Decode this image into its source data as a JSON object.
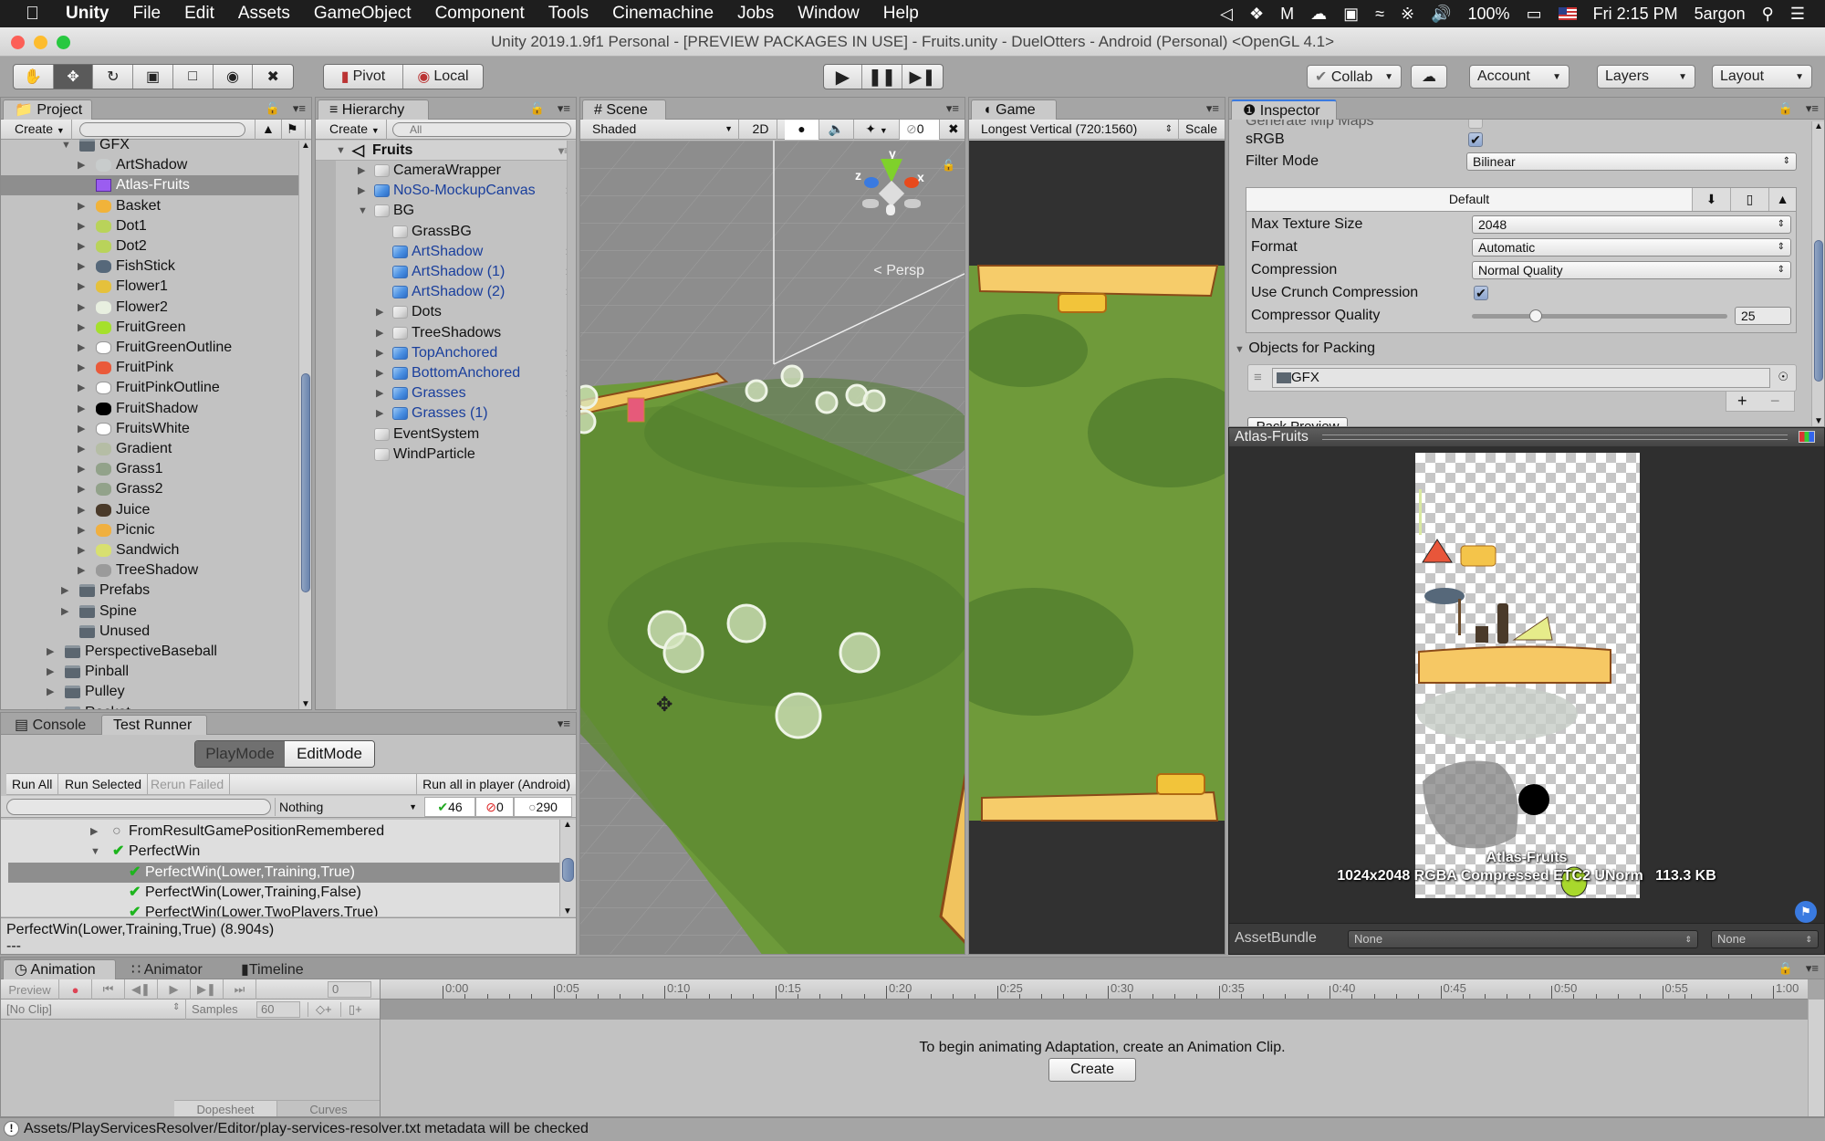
{
  "menubar": {
    "app": "Unity",
    "items": [
      "File",
      "Edit",
      "Assets",
      "GameObject",
      "Component",
      "Tools",
      "Cinemachine",
      "Jobs",
      "Window",
      "Help"
    ],
    "battery": "100%",
    "clock": "Fri 2:15 PM",
    "user": "5argon"
  },
  "window_title": "Unity 2019.1.9f1 Personal - [PREVIEW PACKAGES IN USE] - Fruits.unity - DuelOtters - Android (Personal) <OpenGL 4.1>",
  "toolbar": {
    "tools": [
      "hand-tool",
      "move-tool",
      "rotate-tool",
      "scale-tool",
      "rect-tool",
      "transform-tool",
      "custom-tool"
    ],
    "active_tool": "move-tool",
    "pivot": "Pivot",
    "local": "Local",
    "collab": "Collab",
    "account": "Account",
    "layers": "Layers",
    "layout": "Layout"
  },
  "project": {
    "tab": "Project",
    "create": "Create",
    "search_placeholder": "",
    "items": [
      {
        "label": "GFX",
        "depth": 0,
        "type": "folder",
        "expanded": true
      },
      {
        "label": "ArtShadow",
        "depth": 1,
        "type": "sprite",
        "icon": "#c8cccc"
      },
      {
        "label": "Atlas-Fruits",
        "depth": 1,
        "type": "atlas",
        "selected": true
      },
      {
        "label": "Basket",
        "depth": 1,
        "type": "sprite",
        "icon": "#f1b33a"
      },
      {
        "label": "Dot1",
        "depth": 1,
        "type": "sprite",
        "icon": "#b9d35a"
      },
      {
        "label": "Dot2",
        "depth": 1,
        "type": "sprite",
        "icon": "#b9d35a"
      },
      {
        "label": "FishStick",
        "depth": 1,
        "type": "sprite",
        "icon": "#56687a"
      },
      {
        "label": "Flower1",
        "depth": 1,
        "type": "sprite",
        "icon": "#e5c13c"
      },
      {
        "label": "Flower2",
        "depth": 1,
        "type": "sprite",
        "icon": "#e8efe0"
      },
      {
        "label": "FruitGreen",
        "depth": 1,
        "type": "sprite",
        "icon": "#a5e02c"
      },
      {
        "label": "FruitGreenOutline",
        "depth": 1,
        "type": "sprite",
        "icon": "#ffffff"
      },
      {
        "label": "FruitPink",
        "depth": 1,
        "type": "sprite",
        "icon": "#ea5a3a"
      },
      {
        "label": "FruitPinkOutline",
        "depth": 1,
        "type": "sprite",
        "icon": "#ffffff"
      },
      {
        "label": "FruitShadow",
        "depth": 1,
        "type": "sprite",
        "icon": "#000000"
      },
      {
        "label": "FruitsWhite",
        "depth": 1,
        "type": "sprite",
        "icon": "#ffffff"
      },
      {
        "label": "Gradient",
        "depth": 1,
        "type": "sprite",
        "icon": "#b5bda5"
      },
      {
        "label": "Grass1",
        "depth": 1,
        "type": "sprite",
        "icon": "#92a28a"
      },
      {
        "label": "Grass2",
        "depth": 1,
        "type": "sprite",
        "icon": "#92a28a"
      },
      {
        "label": "Juice",
        "depth": 1,
        "type": "sprite",
        "icon": "#4a3a2a"
      },
      {
        "label": "Picnic",
        "depth": 1,
        "type": "sprite",
        "icon": "#f0b040"
      },
      {
        "label": "Sandwich",
        "depth": 1,
        "type": "sprite",
        "icon": "#d8e070"
      },
      {
        "label": "TreeShadow",
        "depth": 1,
        "type": "sprite",
        "icon": "#9a9a9a"
      },
      {
        "label": "Prefabs",
        "depth": 0,
        "type": "folder",
        "expandable": true
      },
      {
        "label": "Spine",
        "depth": 0,
        "type": "folder",
        "expandable": true
      },
      {
        "label": "Unused",
        "depth": 0,
        "type": "folder"
      },
      {
        "label": "PerspectiveBaseball",
        "depth": -1,
        "type": "folder",
        "expandable": true
      },
      {
        "label": "Pinball",
        "depth": -1,
        "type": "folder",
        "expandable": true
      },
      {
        "label": "Pulley",
        "depth": -1,
        "type": "folder",
        "expandable": true
      },
      {
        "label": "Rocket",
        "depth": -1,
        "type": "folder",
        "expandable": true
      }
    ]
  },
  "hierarchy": {
    "tab": "Hierarchy",
    "create": "Create",
    "search_placeholder": "All",
    "scene": "Fruits",
    "items": [
      {
        "label": "CameraWrapper",
        "depth": 0,
        "prefab": false,
        "expandable": true
      },
      {
        "label": "NoSo-MockupCanvas",
        "depth": 0,
        "prefab": true,
        "expandable": true
      },
      {
        "label": "BG",
        "depth": 0,
        "prefab": false,
        "expanded": true
      },
      {
        "label": "GrassBG",
        "depth": 1,
        "prefab": false
      },
      {
        "label": "ArtShadow",
        "depth": 1,
        "prefab": true
      },
      {
        "label": "ArtShadow (1)",
        "depth": 1,
        "prefab": true
      },
      {
        "label": "ArtShadow (2)",
        "depth": 1,
        "prefab": true
      },
      {
        "label": "Dots",
        "depth": 1,
        "prefab": false,
        "expandable": true
      },
      {
        "label": "TreeShadows",
        "depth": 1,
        "prefab": false,
        "expandable": true
      },
      {
        "label": "TopAnchored",
        "depth": 1,
        "prefab": true,
        "expandable": true
      },
      {
        "label": "BottomAnchored",
        "depth": 1,
        "prefab": true,
        "expandable": true
      },
      {
        "label": "Grasses",
        "depth": 1,
        "prefab": true,
        "expandable": true
      },
      {
        "label": "Grasses (1)",
        "depth": 1,
        "prefab": true,
        "expandable": true
      },
      {
        "label": "EventSystem",
        "depth": 0,
        "prefab": false
      },
      {
        "label": "WindParticle",
        "depth": 0,
        "prefab": false
      }
    ]
  },
  "scene": {
    "tab": "Scene",
    "shading": "Shaded",
    "mode_2d": "2D",
    "hidden_count": "0",
    "projection": "Persp",
    "axes": {
      "x": "x",
      "y": "y",
      "z": "z"
    }
  },
  "game": {
    "tab": "Game",
    "resolution": "Longest Vertical (720:1560)",
    "scale": "Scale"
  },
  "inspector": {
    "tab": "Inspector",
    "cut_label": "Generate Mip Maps",
    "srgb_label": "sRGB",
    "srgb": true,
    "filter_label": "Filter Mode",
    "filter": "Bilinear",
    "platform_tab": "Default",
    "max_size_label": "Max Texture Size",
    "max_size": "2048",
    "format_label": "Format",
    "format": "Automatic",
    "compression_label": "Compression",
    "compression": "Normal Quality",
    "crunch_label": "Use Crunch Compression",
    "crunch": true,
    "quality_label": "Compressor Quality",
    "quality": "25",
    "quality_fraction": 0.25,
    "packing_label": "Objects for Packing",
    "packing_item": "GFX",
    "pack_preview": "Pack Preview"
  },
  "preview": {
    "title": "Atlas-Fruits",
    "name": "Atlas-Fruits",
    "info": "1024x2048 RGBA Compressed ETC2 UNorm   113.3 KB",
    "assetbundle_label": "AssetBundle",
    "assetbundle": "None",
    "variant": "None"
  },
  "testrunner": {
    "tabs": [
      "Console",
      "Test Runner"
    ],
    "active_tab": "Test Runner",
    "modes": [
      "PlayMode",
      "EditMode"
    ],
    "active_mode": "PlayMode",
    "run_all": "Run All",
    "run_selected": "Run Selected",
    "rerun_failed": "Rerun Failed",
    "run_player": "Run all in player (Android)",
    "filter": "Nothing",
    "passed": "46",
    "failed": "0",
    "notrun": "290",
    "tests": [
      {
        "label": "FromResultGamePositionRemembered",
        "state": "notrun",
        "depth": 0,
        "expandable": true
      },
      {
        "label": "PerfectWin",
        "state": "pass",
        "depth": 0,
        "expanded": true
      },
      {
        "label": "PerfectWin(Lower,Training,True)",
        "state": "pass",
        "depth": 1,
        "selected": true
      },
      {
        "label": "PerfectWin(Lower,Training,False)",
        "state": "pass",
        "depth": 1
      },
      {
        "label": "PerfectWin(Lower,TwoPlayers,True)",
        "state": "pass",
        "depth": 1
      }
    ],
    "detail": "PerfectWin(Lower,Training,True) (8.904s)",
    "detail2": "---"
  },
  "animation": {
    "tabs": [
      "Animation",
      "Animator",
      "Timeline"
    ],
    "active_tab": "Animation",
    "preview": "Preview",
    "frame": "0",
    "clip": "[No Clip]",
    "samples_label": "Samples",
    "samples": "60",
    "time_labels": [
      "0:00",
      "0:05",
      "0:10",
      "0:15",
      "0:20",
      "0:25",
      "0:30",
      "0:35",
      "0:40",
      "0:45",
      "0:50",
      "0:55",
      "1:00"
    ],
    "message": "To begin animating Adaptation, create an Animation Clip.",
    "create": "Create",
    "dopesheet": "Dopesheet",
    "curves": "Curves"
  },
  "status": "Assets/PlayServicesResolver/Editor/play-services-resolver.txt metadata will be checked"
}
